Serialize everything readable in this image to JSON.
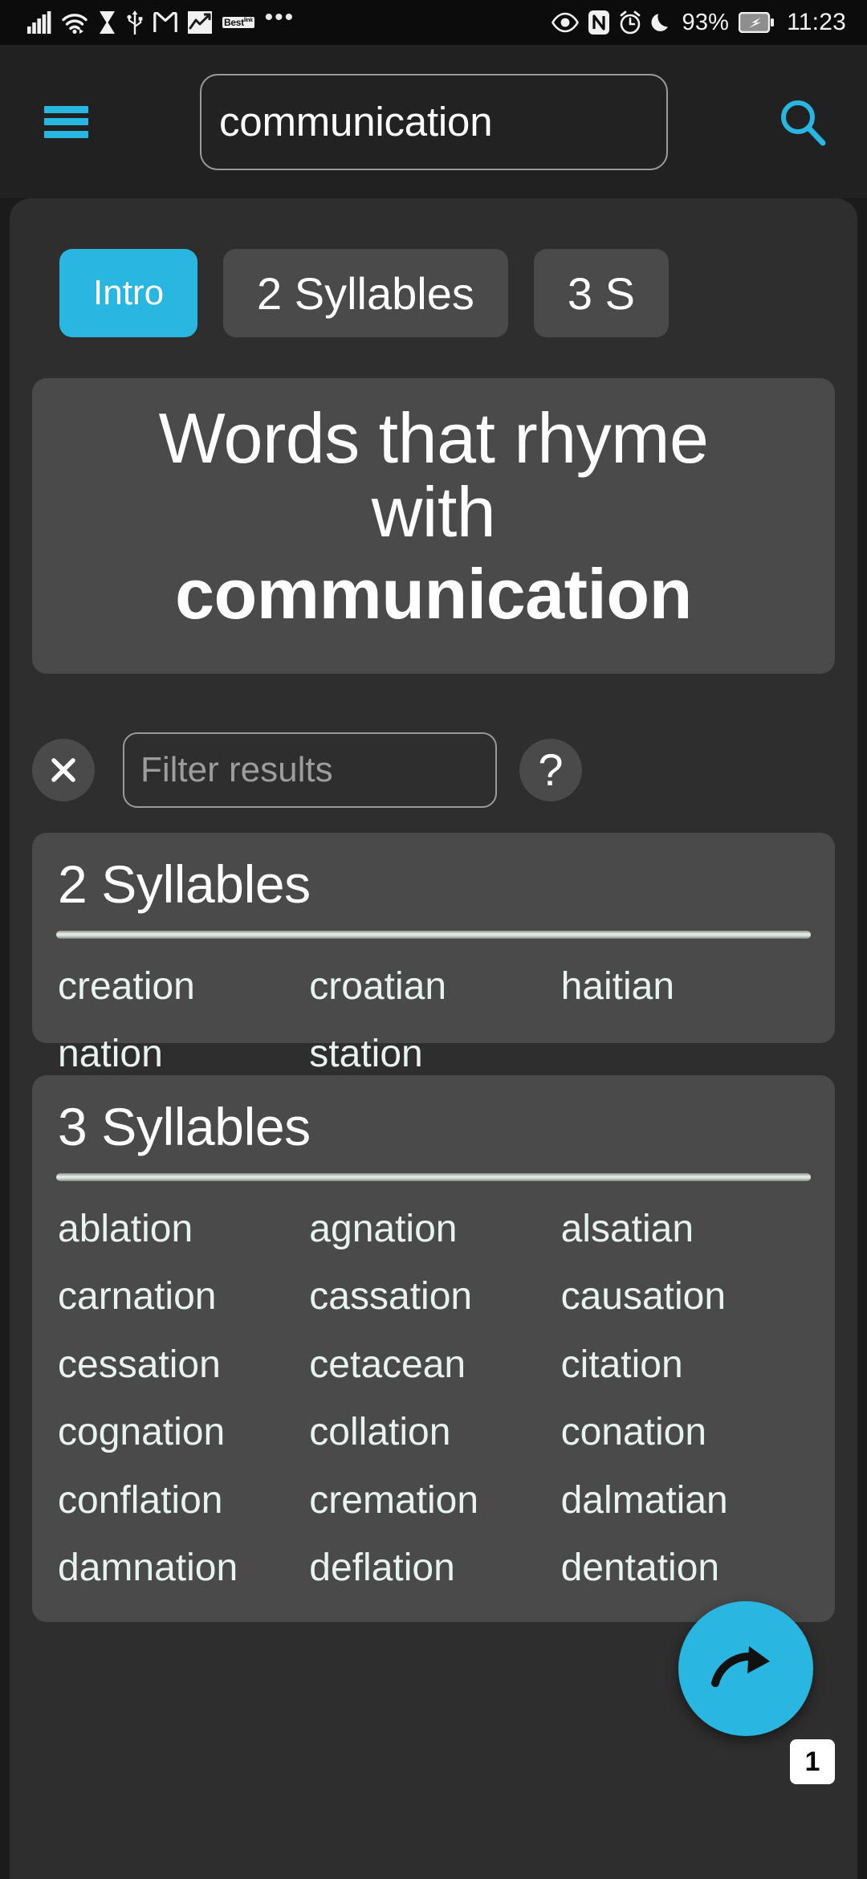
{
  "statusbar": {
    "icons_left": [
      "signal-icon",
      "wifi-icon",
      "hourglass-icon",
      "usb-icon",
      "gmail-icon",
      "stocks-icon",
      "best-badge-icon",
      "more-icon"
    ],
    "best_label": "Best",
    "best_sup": "link",
    "more_label": "•••",
    "icons_right": [
      "eye-icon",
      "nfc-icon",
      "alarm-icon",
      "moon-icon"
    ],
    "battery_percent": "93%",
    "battery_icon": "battery-charging-icon",
    "time": "11:23"
  },
  "appbar": {
    "menu_icon": "hamburger-menu-icon",
    "search_value": "communication",
    "search_placeholder": "Search",
    "search_icon": "search-icon"
  },
  "tabs": [
    {
      "label": "Intro",
      "active": true
    },
    {
      "label": "2 Syllables",
      "active": false
    },
    {
      "label": "3 S",
      "active": false
    }
  ],
  "title_card": {
    "line1": "Words that rhyme",
    "line2": "with",
    "keyword": "communication"
  },
  "filter": {
    "clear_icon": "close-icon",
    "placeholder": "Filter results",
    "value": "",
    "help_icon": "question-mark-icon",
    "help_label": "?"
  },
  "sections": [
    {
      "heading": "2 Syllables",
      "words": [
        "creation",
        "croatian",
        "haitian",
        "nation",
        "station"
      ]
    },
    {
      "heading": "3 Syllables",
      "words": [
        "ablation",
        "agnation",
        "alsatian",
        "carnation",
        "cassation",
        "causation",
        "cessation",
        "cetacean",
        "citation",
        "cognation",
        "collation",
        "conation",
        "conflation",
        "cremation",
        "dalmatian",
        "damnation",
        "deflation",
        "dentation"
      ]
    }
  ],
  "fab": {
    "icon": "redo-arrow-icon",
    "page_badge": "1"
  },
  "colors": {
    "accent": "#29b6e0",
    "panel_bg": "#2e2e2e",
    "card_bg": "#4a4a4a",
    "appbar_bg": "#212121",
    "statusbar_bg": "#0c0c0c",
    "word_text": "#e8f3f0"
  }
}
